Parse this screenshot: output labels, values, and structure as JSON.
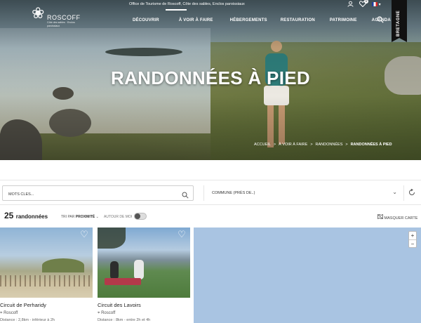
{
  "topbar": {
    "text": "Office de Tourisme de Roscoff, Côte des sables, Enclos paroissiaux",
    "favorites_count": "0",
    "language": "FR"
  },
  "logo": {
    "name": "ROSCOFF",
    "tagline": "Côte des sables · Enclos paroissiaux"
  },
  "nav": {
    "items": [
      "DÉCOUVRIR",
      "À VOIR À FAIRE",
      "HÉBERGEMENTS",
      "RESTAURATION",
      "PATRIMOINE",
      "AGENDA"
    ]
  },
  "bretagne": "BRETAGNE",
  "hero": {
    "title": "RANDONNÉES À PIED",
    "breadcrumb": [
      "ACCUEIL",
      ">",
      "À VOIR À FAIRE",
      ">",
      "RANDONNÉES",
      ">",
      "RANDONNÉES À PIED"
    ]
  },
  "filters": {
    "keywords_placeholder": "MOTS CLÉS...",
    "commune_label": "COMMUNE (PRÈS DE..)"
  },
  "results": {
    "count": "25",
    "count_label": "randonnées",
    "sort_prefix": "TRI PAR",
    "sort_value": "PROXIMITÉ",
    "around_label": "AUTOUR DE MOI",
    "hide_map": "MASQUER CARTE"
  },
  "cards": [
    {
      "title": "Circuit de Perharidy",
      "place": "Roscoff",
      "meta": "Distance : 2,8km - inférieur à 2h"
    },
    {
      "title": "Circuit des Lavoirs",
      "place": "Roscoff",
      "meta": "Distance : 8km - entre 2h et 4h"
    }
  ],
  "map": {
    "zoom_in": "+",
    "zoom_out": "−"
  },
  "colors": {
    "map_water": "#a9c4e2",
    "text_dark": "#222222"
  }
}
